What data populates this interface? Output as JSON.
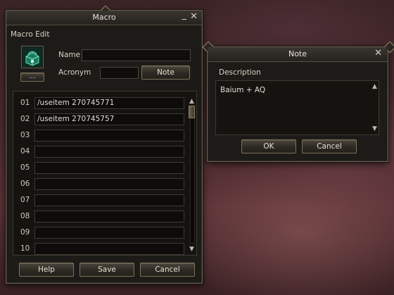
{
  "macro_window": {
    "title": "Macro",
    "minimize_glyph": "_",
    "close_glyph": "✕",
    "section_label": "Macro Edit",
    "icon_button_label": "....",
    "name_label": "Name",
    "name_value": "",
    "acronym_label": "Acronym",
    "acronym_value": "",
    "note_button": "Note",
    "rows": [
      {
        "num": "01",
        "cmd": "/useitem 270745771"
      },
      {
        "num": "02",
        "cmd": "/useitem 270745757"
      },
      {
        "num": "03",
        "cmd": ""
      },
      {
        "num": "04",
        "cmd": ""
      },
      {
        "num": "05",
        "cmd": ""
      },
      {
        "num": "06",
        "cmd": ""
      },
      {
        "num": "07",
        "cmd": ""
      },
      {
        "num": "08",
        "cmd": ""
      },
      {
        "num": "09",
        "cmd": ""
      },
      {
        "num": "10",
        "cmd": ""
      }
    ],
    "help_button": "Help",
    "save_button": "Save",
    "cancel_button": "Cancel"
  },
  "note_window": {
    "title": "Note",
    "close_glyph": "✕",
    "description_label": "Description",
    "description_text": "Baium + AQ",
    "ok_button": "OK",
    "cancel_button": "Cancel"
  },
  "colors": {
    "frame_border": "#6f6552",
    "panel_bg": "#1d1b18",
    "text": "#d8d2c4",
    "icon_green": "#3fc19a"
  }
}
